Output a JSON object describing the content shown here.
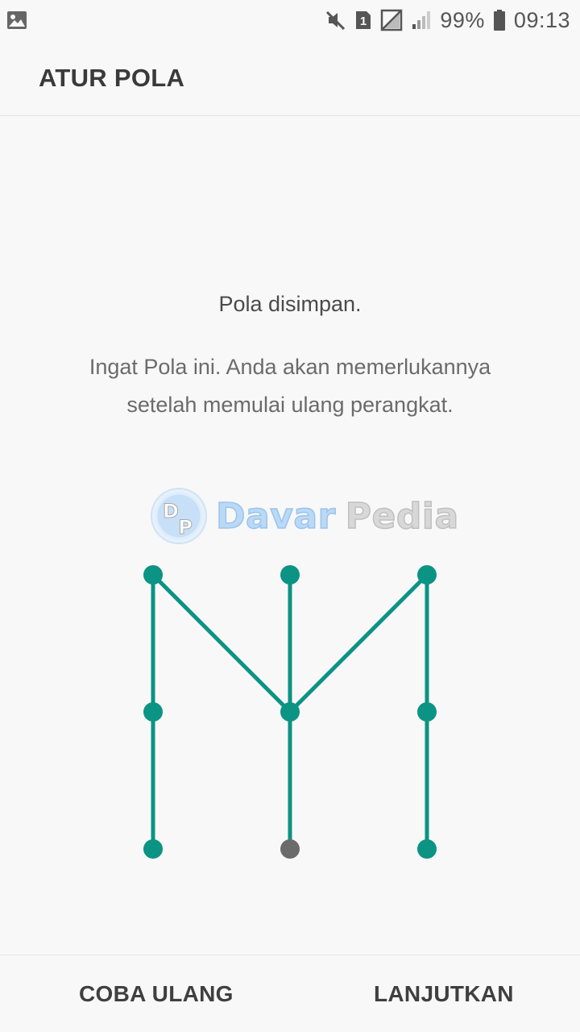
{
  "status_bar": {
    "battery_percent": "99%",
    "time": "09:13",
    "sim_slot": "1",
    "icons": [
      "gallery-icon",
      "mute-icon",
      "sim-icon",
      "no-signal-icon",
      "signal-icon",
      "battery-icon"
    ]
  },
  "header": {
    "title": "ATUR POLA"
  },
  "message": {
    "title": "Pola disimpan.",
    "body": "Ingat Pola ini. Anda akan memerlukannya setelah memulai ulang perangkat."
  },
  "watermark": {
    "badge_letter_1": "D",
    "badge_letter_2": "P",
    "word_1": "Davar",
    "word_2": "Pedia"
  },
  "pattern": {
    "grid": "3x3",
    "active_color": "#0b9384",
    "inactive_color": "#6b6b6b",
    "sequence": [
      7,
      4,
      1,
      5,
      3,
      6,
      9
    ],
    "extra_strokes": [
      [
        2,
        5
      ],
      [
        5,
        8
      ]
    ],
    "active_dots": [
      1,
      2,
      3,
      4,
      5,
      6,
      7,
      9
    ],
    "inactive_dots": [
      8
    ]
  },
  "buttons": {
    "retry": "COBA ULANG",
    "next": "LANJUTKAN"
  }
}
